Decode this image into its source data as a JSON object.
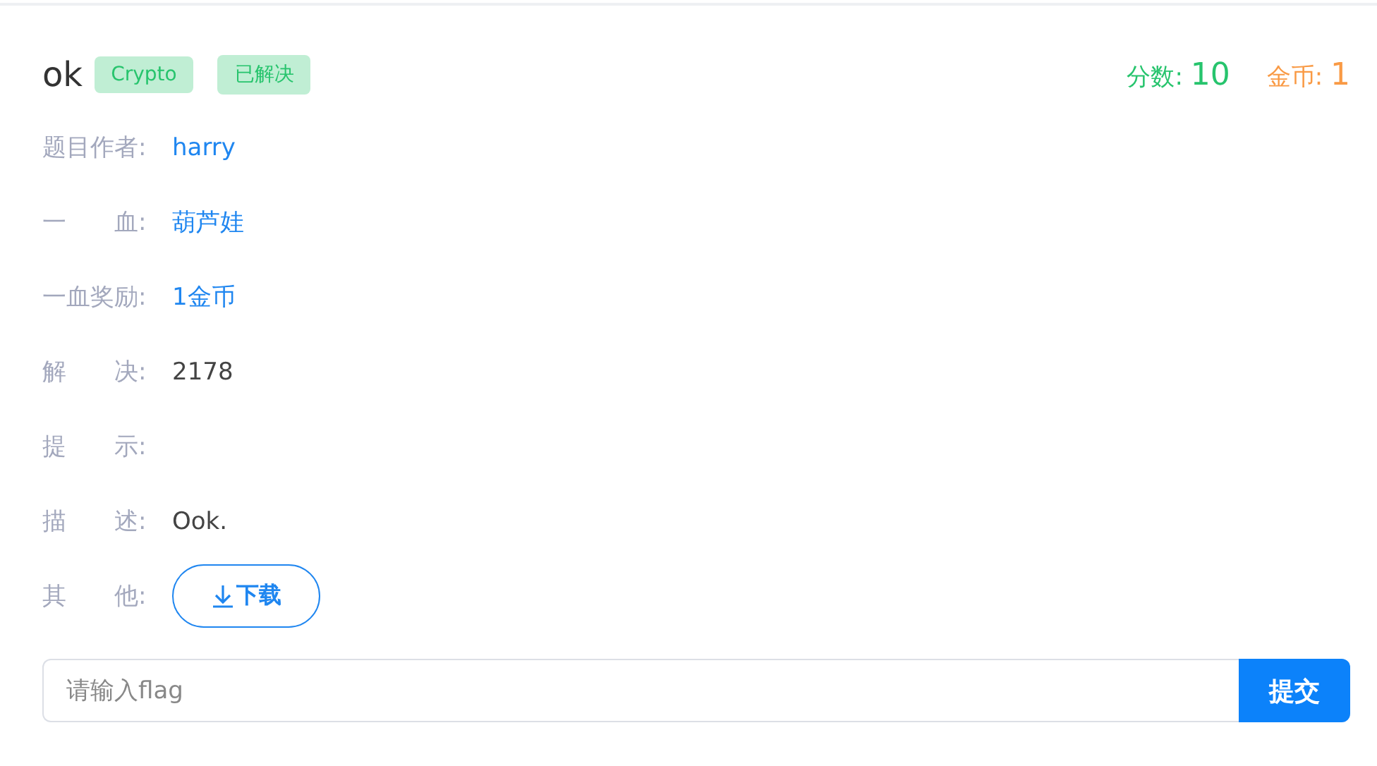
{
  "challenge": {
    "title": "ok",
    "tags": [
      {
        "label": "Crypto"
      },
      {
        "label": "已解决"
      }
    ],
    "score": {
      "label": "分数:",
      "value": "10"
    },
    "coins": {
      "label": "金币:",
      "value": "1"
    }
  },
  "details": [
    {
      "label": "题目作者:",
      "value": "harry",
      "kind": "link"
    },
    {
      "label": "一　　血:",
      "value": "葫芦娃",
      "kind": "link"
    },
    {
      "label": "一血奖励:",
      "value": "1金币",
      "kind": "link"
    },
    {
      "label": "解　　决:",
      "value": "2178",
      "kind": "text"
    },
    {
      "label": "提　　示:",
      "kind": "text"
    },
    {
      "label": "描　　述:",
      "value": "Ook.",
      "kind": "text"
    },
    {
      "label": "其　　他:",
      "button": "下载",
      "kind": "download"
    }
  ],
  "flag_form": {
    "placeholder": "请输入flag",
    "submit": "提交"
  }
}
